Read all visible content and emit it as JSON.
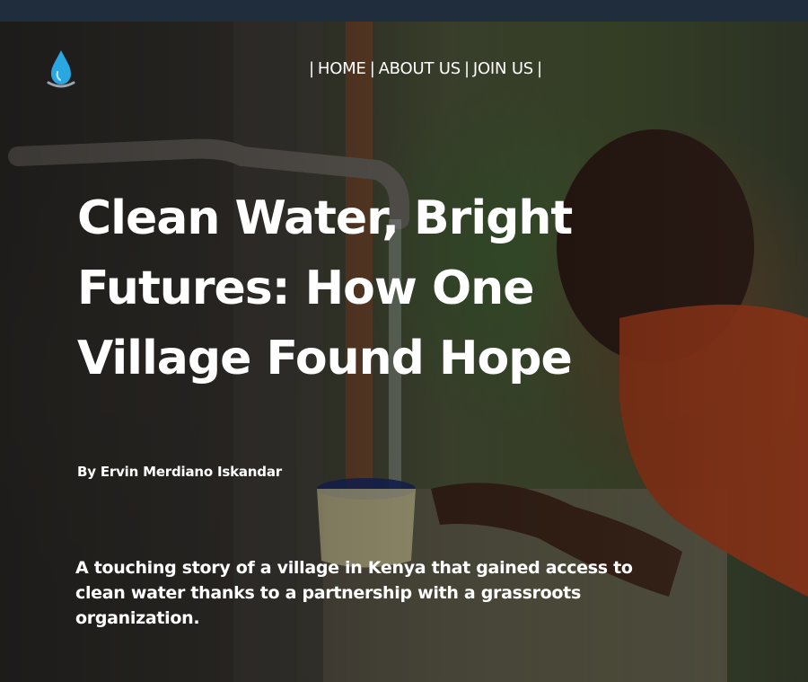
{
  "nav": {
    "separator": "|",
    "items": [
      {
        "label": "HOME"
      },
      {
        "label": "ABOUT US"
      },
      {
        "label": "JOIN US"
      }
    ]
  },
  "logo": {
    "icon": "water-drop-icon",
    "color": "#2aa6e0"
  },
  "article": {
    "title": "Clean Water, Bright Futures: How One Village Found Hope",
    "byline": "By Ervin Merdiano Iskandar",
    "summary": "A touching story of a village in Kenya that gained access to clean water thanks to a partnership with a grassroots organization."
  },
  "colors": {
    "topbar": "#1f2d3d",
    "text": "#ffffff",
    "accent": "#2aa6e0"
  }
}
